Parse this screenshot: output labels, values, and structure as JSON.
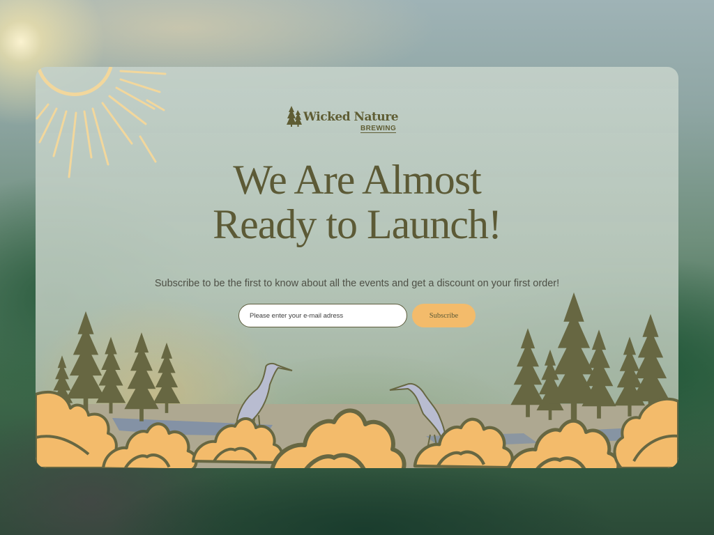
{
  "brand": {
    "name": "Wicked Nature",
    "sub": "BREWING"
  },
  "hero": {
    "headline_line1": "We Are Almost",
    "headline_line2": "Ready to Launch!",
    "subtitle": "Subscribe to be the first to know about all the events and get a discount on your first order!"
  },
  "form": {
    "email_placeholder": "Please enter your e-mail adress",
    "email_value": "",
    "subscribe_label": "Subscribe"
  },
  "colors": {
    "accent": "#f3bb6b",
    "text_olive": "#5c5a36",
    "tree": "#676742",
    "heron": "#b8bcd0",
    "sun": "#f2d79c"
  },
  "icons": [
    "sun-icon",
    "pine-tree-icon",
    "heron-icon",
    "leaf-icon"
  ]
}
